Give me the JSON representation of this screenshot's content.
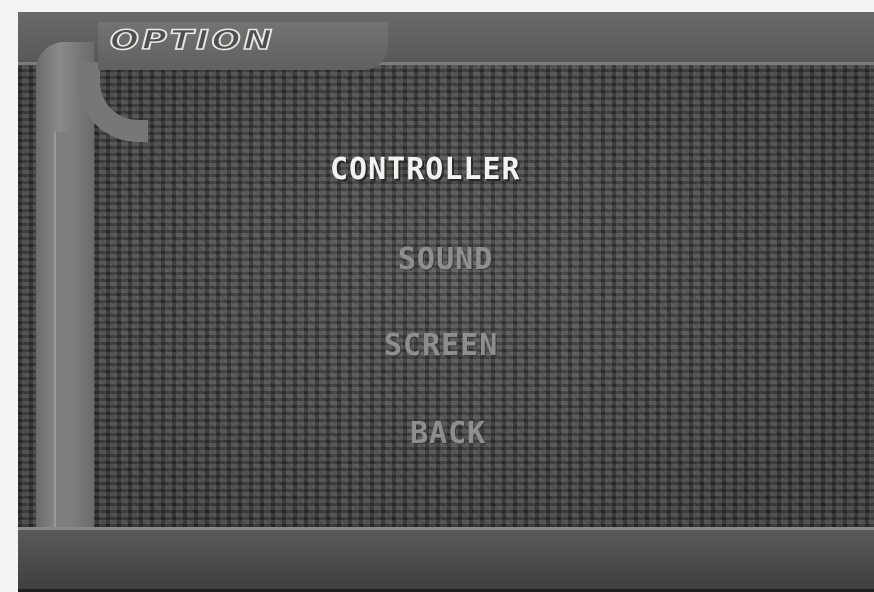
{
  "header": {
    "title": "OPTION"
  },
  "menu": {
    "items": [
      {
        "label": "CONTROLLER",
        "selected": true
      },
      {
        "label": "SOUND",
        "selected": false
      },
      {
        "label": "SCREEN",
        "selected": false
      },
      {
        "label": "BACK",
        "selected": false
      }
    ]
  },
  "colors": {
    "selected_text": "#f2f2f0",
    "unselected_text": "#8e8e8c",
    "frame": "#6b6b69"
  }
}
